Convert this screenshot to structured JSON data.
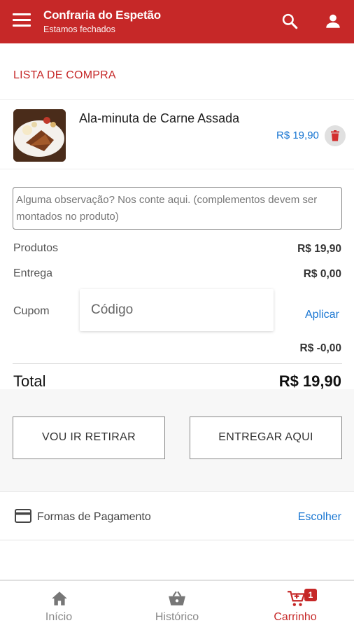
{
  "header": {
    "menu_icon": "menu-icon",
    "title": "Confraria do Espetão",
    "subtitle": "Estamos fechados",
    "search_icon": "search-icon",
    "user_icon": "person-icon"
  },
  "cart": {
    "section_title": "LISTA DE COMPRA",
    "items": [
      {
        "name": "Ala-minuta de Carne Assada",
        "price": "R$ 19,90",
        "delete_icon": "trash-icon"
      }
    ],
    "observation_placeholder": "Alguma observação? Nos conte aqui. (complementos devem ser montados no produto)"
  },
  "summary": {
    "products_label": "Produtos",
    "products_value": "R$ 19,90",
    "delivery_label": "Entrega",
    "delivery_value": "R$ 0,00",
    "coupon_label": "Cupom",
    "coupon_placeholder": "Código",
    "coupon_apply": "Aplicar",
    "discount_value": "R$ -0,00",
    "total_label": "Total",
    "total_value": "R$ 19,90"
  },
  "delivery_options": {
    "pickup": "VOU IR RETIRAR",
    "deliver": "ENTREGAR AQUI"
  },
  "payment": {
    "icon": "credit-card-icon",
    "label": "Formas de Pagamento",
    "choose": "Escolher"
  },
  "bottom_nav": {
    "items": [
      {
        "label": "Início",
        "icon": "home-icon"
      },
      {
        "label": "Histórico",
        "icon": "basket-icon"
      },
      {
        "label": "Carrinho",
        "icon": "cart-icon",
        "badge": "1"
      }
    ]
  },
  "colors": {
    "primary": "#c62828",
    "link": "#1976d2"
  }
}
